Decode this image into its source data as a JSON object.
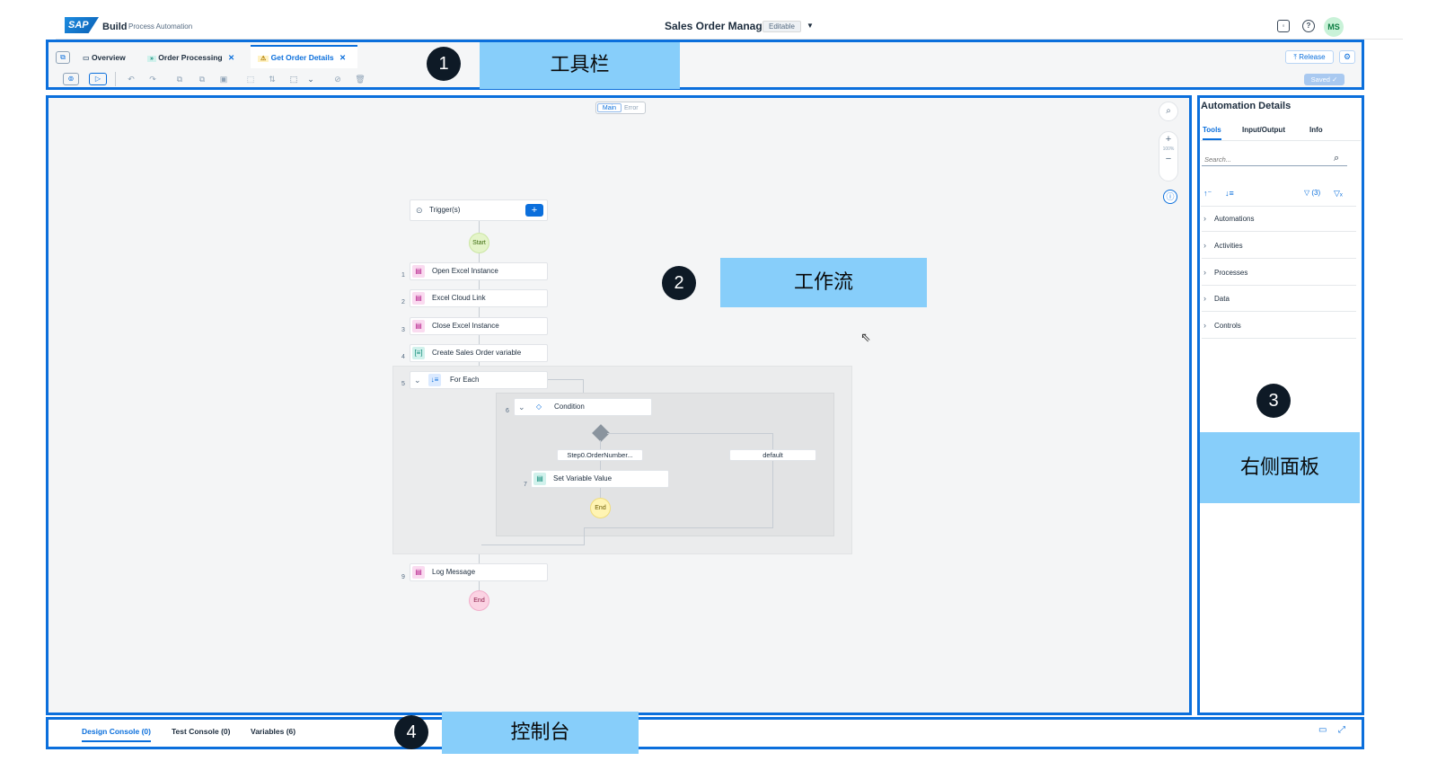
{
  "shell": {
    "logo": "SAP",
    "build": "Build",
    "product": "Process Automation",
    "project_title": "Sales Order Management",
    "status": "Editable",
    "avatar": "MS"
  },
  "toolbar": {
    "tabs": [
      {
        "label": "Overview"
      },
      {
        "label": "Order Processing"
      },
      {
        "label": "Get Order Details"
      }
    ],
    "release_label": "Release",
    "saved_label": "Saved"
  },
  "canvas": {
    "view_main": "Main",
    "view_error": "Error",
    "zoom": "100%",
    "trigger_label": "Trigger(s)",
    "start_label": "Start",
    "steps": [
      {
        "num": "1",
        "label": "Open Excel Instance"
      },
      {
        "num": "2",
        "label": "Excel Cloud Link"
      },
      {
        "num": "3",
        "label": "Close Excel Instance"
      },
      {
        "num": "4",
        "label": "Create Sales Order variable"
      },
      {
        "num": "5",
        "label": "For Each"
      },
      {
        "num": "6",
        "label": "Condition"
      },
      {
        "num": "7",
        "label": "Set Variable Value"
      },
      {
        "num": "9",
        "label": "Log Message"
      }
    ],
    "branch_condition": "Step0.OrderNumber...",
    "branch_default": "default",
    "inner_end": "End",
    "end_label": "End"
  },
  "panel": {
    "title": "Automation Details",
    "tabs": [
      "Tools",
      "Input/Output",
      "Info"
    ],
    "search_placeholder": "Search...",
    "filter_count": "(3)",
    "items": [
      "Automations",
      "Activities",
      "Processes",
      "Data",
      "Controls"
    ]
  },
  "console": {
    "tabs": [
      "Design Console (0)",
      "Test Console (0)",
      "Variables (6)"
    ]
  },
  "callouts": [
    {
      "num": "1",
      "label": "工具栏"
    },
    {
      "num": "2",
      "label": "工作流"
    },
    {
      "num": "3",
      "label": "右侧面板"
    },
    {
      "num": "4",
      "label": "控制台"
    }
  ],
  "colors": {
    "accent": "#0b6fdc",
    "callout_fill": "#87cefa"
  }
}
